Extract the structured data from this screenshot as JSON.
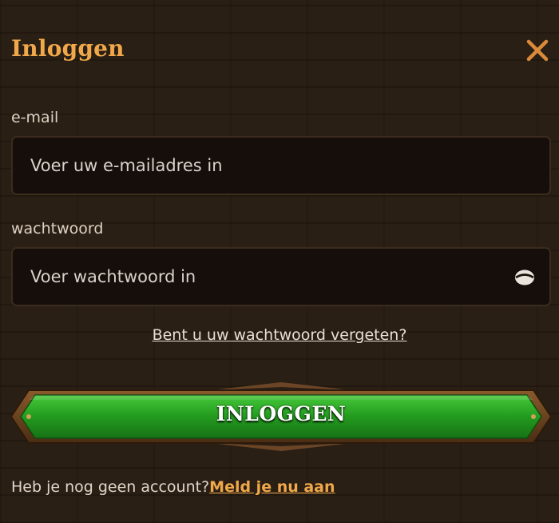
{
  "dialog": {
    "title": "Inloggen",
    "close_icon": "close-icon"
  },
  "email": {
    "label": "e-mail",
    "value": "",
    "placeholder": "Voer uw e-mailadres in"
  },
  "password": {
    "label": "wachtwoord",
    "value": "",
    "placeholder": "Voer wachtwoord in",
    "toggle_icon": "eye-icon"
  },
  "forgot_link": "Bent u uw wachtwoord vergeten?",
  "login_button": "INLOGGEN",
  "signup": {
    "prompt": "Heb je nog geen account?",
    "link": "Meld je nu aan"
  },
  "colors": {
    "background": "#2a1f14",
    "accent": "#f0a84a",
    "input_bg": "#150e0b",
    "button_green": "#2fa82a"
  }
}
